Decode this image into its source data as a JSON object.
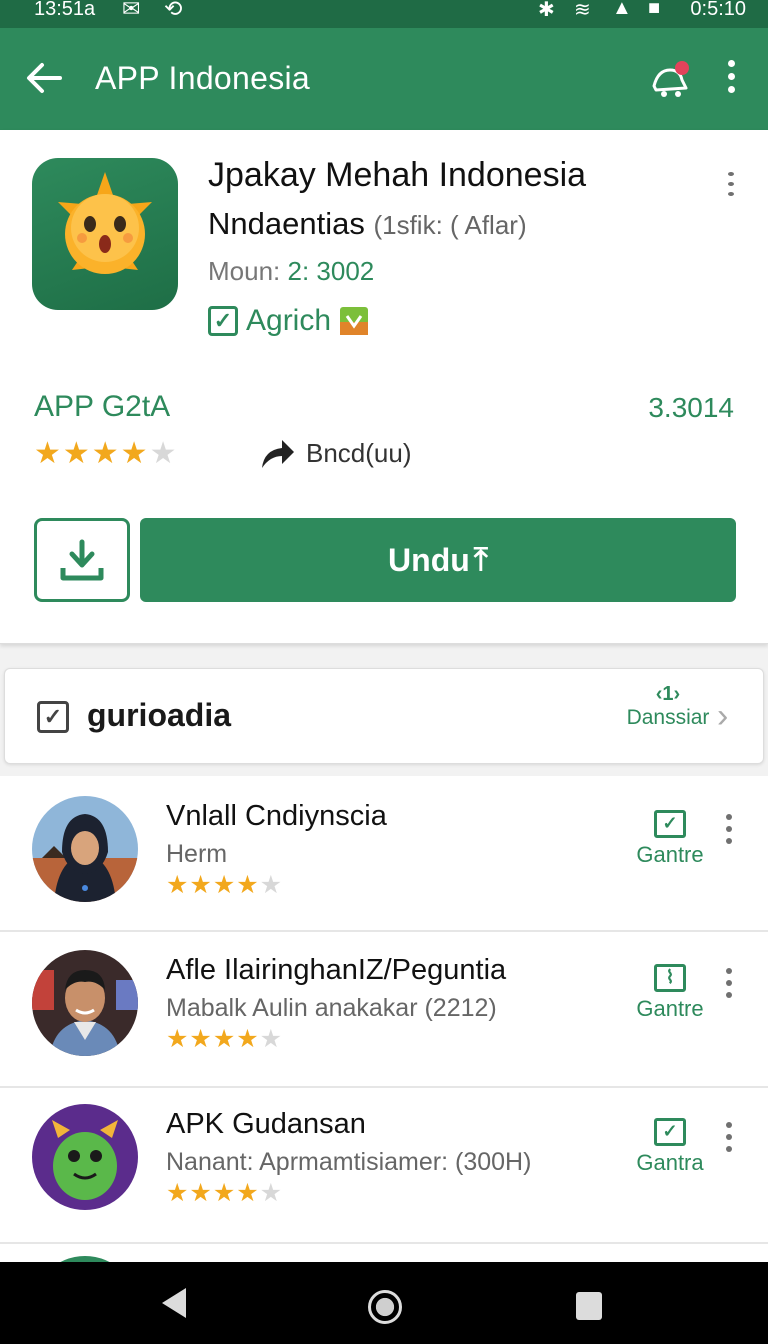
{
  "status_bar": {
    "time": "13:51a",
    "clock": "0:5:10"
  },
  "appbar": {
    "title": "APP Indonesia"
  },
  "app": {
    "title": "Jpakay Mehah Indonesia",
    "subtitle": "Nndaentias",
    "subtitle_note": "(1sfik: ( Aflar)",
    "meta_label": "Moun:",
    "meta_value": "2: 3002",
    "badge": "Agrich",
    "rating_label": "APP G2tA",
    "rating_count": "3.3014",
    "rating_stars": 4,
    "share_label": "Bncd(uu)",
    "download_label": "Undu"
  },
  "section": {
    "title": "gurioadia",
    "more_glyph": "‹1›",
    "more_label": "Danssiar"
  },
  "list": [
    {
      "name": "Vnlall Cndiynscia",
      "sub": "Herm",
      "stars": 4,
      "action": "Gantre",
      "avatar": "person-hijab"
    },
    {
      "name": "Afle IlairinghanIZ/Peguntia",
      "sub": "Mabalk Aulin anakakar (2212)",
      "stars": 4,
      "action": "Gantre",
      "avatar": "person-man"
    },
    {
      "name": "APK Gudansan",
      "sub": "Nanant: Aprmamtisiamer: (300H)",
      "stars": 4,
      "action": "Gantra",
      "avatar": "green-monster"
    }
  ],
  "colors": {
    "accent": "#2e8a5c",
    "star": "#f2a81d"
  }
}
